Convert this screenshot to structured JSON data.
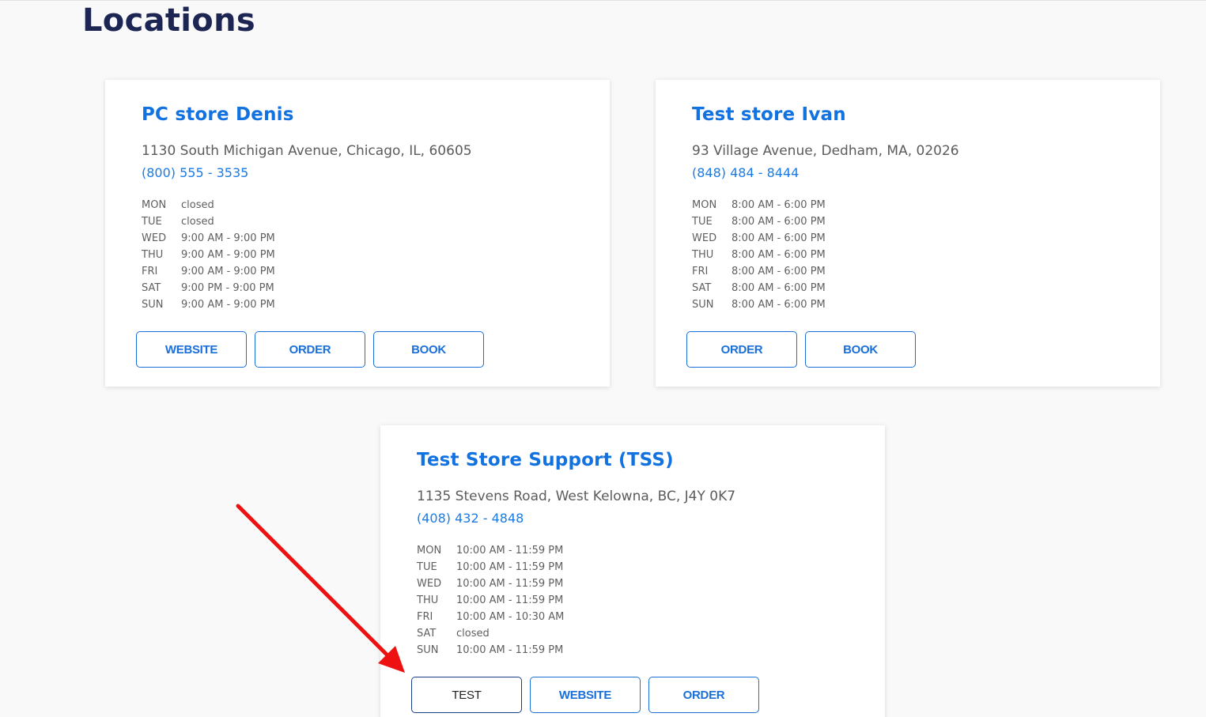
{
  "page": {
    "title": "Locations"
  },
  "colors": {
    "accent": "#1172e0",
    "heading": "#1d2552",
    "annotation_arrow": "#ee1111"
  },
  "stores": [
    {
      "name": "PC store Denis",
      "address": "1130 South Michigan Avenue, Chicago, IL, 60605",
      "phone": "(800) 555 - 3535",
      "hours": [
        {
          "day": "MON",
          "time": "closed"
        },
        {
          "day": "TUE",
          "time": "closed"
        },
        {
          "day": "WED",
          "time": "9:00 AM - 9:00 PM"
        },
        {
          "day": "THU",
          "time": "9:00 AM - 9:00 PM"
        },
        {
          "day": "FRI",
          "time": "9:00 AM - 9:00 PM"
        },
        {
          "day": "SAT",
          "time": "9:00 PM - 9:00 PM"
        },
        {
          "day": "SUN",
          "time": "9:00 AM - 9:00 PM"
        }
      ],
      "buttons": [
        "WEBSITE",
        "ORDER",
        "BOOK"
      ]
    },
    {
      "name": "Test store Ivan",
      "address": "93 Village Avenue, Dedham, MA, 02026",
      "phone": "(848) 484 - 8444",
      "hours": [
        {
          "day": "MON",
          "time": "8:00 AM - 6:00 PM"
        },
        {
          "day": "TUE",
          "time": "8:00 AM - 6:00 PM"
        },
        {
          "day": "WED",
          "time": "8:00 AM - 6:00 PM"
        },
        {
          "day": "THU",
          "time": "8:00 AM - 6:00 PM"
        },
        {
          "day": "FRI",
          "time": "8:00 AM - 6:00 PM"
        },
        {
          "day": "SAT",
          "time": "8:00 AM - 6:00 PM"
        },
        {
          "day": "SUN",
          "time": "8:00 AM - 6:00 PM"
        }
      ],
      "buttons": [
        "ORDER",
        "BOOK"
      ]
    },
    {
      "name": "Test Store Support (TSS)",
      "address": "1135 Stevens Road, West Kelowna, BC, J4Y 0K7",
      "phone": "(408) 432 - 4848",
      "hours": [
        {
          "day": "MON",
          "time": "10:00 AM - 11:59 PM"
        },
        {
          "day": "TUE",
          "time": "10:00 AM - 11:59 PM"
        },
        {
          "day": "WED",
          "time": "10:00 AM - 11:59 PM"
        },
        {
          "day": "THU",
          "time": "10:00 AM - 11:59 PM"
        },
        {
          "day": "FRI",
          "time": "10:00 AM - 10:30 AM"
        },
        {
          "day": "SAT",
          "time": "closed"
        },
        {
          "day": "SUN",
          "time": "10:00 AM - 11:59 PM"
        }
      ],
      "buttons": [
        "TEST",
        "WEBSITE",
        "ORDER"
      ]
    }
  ]
}
